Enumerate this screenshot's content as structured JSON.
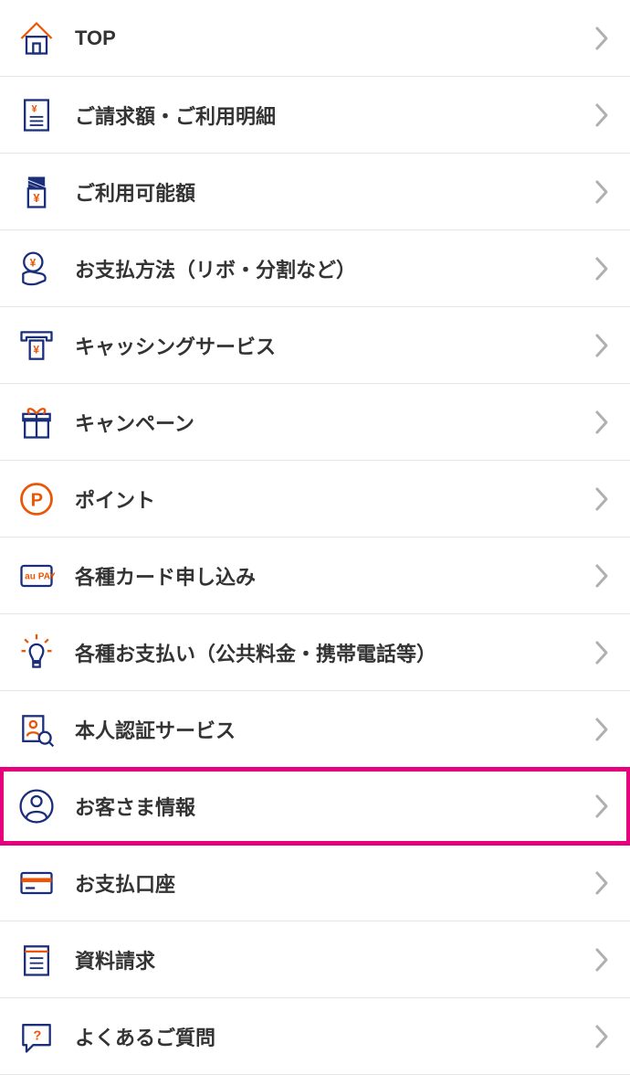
{
  "menu": {
    "items": [
      {
        "label": "TOP",
        "icon": "home-icon",
        "highlighted": false
      },
      {
        "label": "ご請求額・ご利用明細",
        "icon": "billing-doc-icon",
        "highlighted": false
      },
      {
        "label": "ご利用可能額",
        "icon": "card-limit-icon",
        "highlighted": false
      },
      {
        "label": "お支払方法（リボ・分割など）",
        "icon": "hand-yen-icon",
        "highlighted": false
      },
      {
        "label": "キャッシングサービス",
        "icon": "atm-icon",
        "highlighted": false
      },
      {
        "label": "キャンペーン",
        "icon": "gift-icon",
        "highlighted": false
      },
      {
        "label": "ポイント",
        "icon": "point-icon",
        "highlighted": false
      },
      {
        "label": "各種カード申し込み",
        "icon": "aupay-card-icon",
        "highlighted": false
      },
      {
        "label": "各種お支払い（公共料金・携帯電話等）",
        "icon": "lightbulb-icon",
        "highlighted": false
      },
      {
        "label": "本人認証サービス",
        "icon": "id-check-icon",
        "highlighted": false
      },
      {
        "label": "お客さま情報",
        "icon": "person-circle-icon",
        "highlighted": true
      },
      {
        "label": "お支払口座",
        "icon": "bank-card-icon",
        "highlighted": false
      },
      {
        "label": "資料請求",
        "icon": "doc-request-icon",
        "highlighted": false
      },
      {
        "label": "よくあるご質問",
        "icon": "faq-icon",
        "highlighted": false
      }
    ]
  },
  "colors": {
    "orange": "#eb5505",
    "navy": "#1a2e7a",
    "highlight": "#e6007e",
    "chevron": "#b0b0b0"
  }
}
